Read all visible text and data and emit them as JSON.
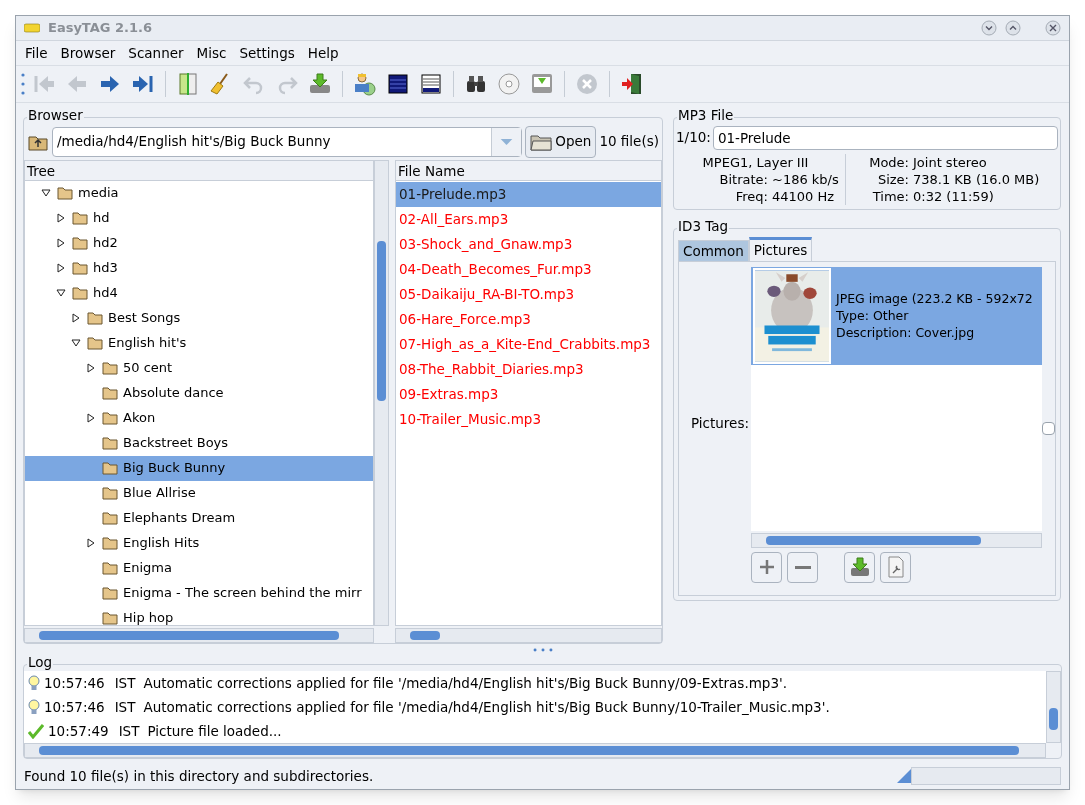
{
  "window": {
    "title": "EasyTAG 2.1.6"
  },
  "menu": [
    {
      "label": "File"
    },
    {
      "label": "Browser"
    },
    {
      "label": "Scanner"
    },
    {
      "label": "Misc"
    },
    {
      "label": "Settings"
    },
    {
      "label": "Help"
    }
  ],
  "toolbar": [
    {
      "kind": "first",
      "disabled": true
    },
    {
      "kind": "prev",
      "disabled": true
    },
    {
      "kind": "next",
      "disabled": false
    },
    {
      "kind": "last",
      "disabled": false
    },
    {
      "kind": "sep"
    },
    {
      "kind": "book",
      "disabled": false
    },
    {
      "kind": "broom",
      "disabled": false
    },
    {
      "kind": "undo",
      "disabled": true
    },
    {
      "kind": "redo",
      "disabled": true
    },
    {
      "kind": "save",
      "disabled": false
    },
    {
      "kind": "sep"
    },
    {
      "kind": "person",
      "disabled": false
    },
    {
      "kind": "list",
      "disabled": false
    },
    {
      "kind": "list2",
      "disabled": false
    },
    {
      "kind": "sep"
    },
    {
      "kind": "binoculars",
      "disabled": false
    },
    {
      "kind": "cd",
      "disabled": false
    },
    {
      "kind": "save2",
      "disabled": false
    },
    {
      "kind": "sep"
    },
    {
      "kind": "stop",
      "disabled": true
    },
    {
      "kind": "sep"
    },
    {
      "kind": "exit",
      "disabled": false
    }
  ],
  "browser": {
    "title": "Browser",
    "path": "/media/hd4/English hit's/Big Buck Bunny",
    "open_button": "Open",
    "file_count": "10 file(s)",
    "tree_header": "Tree",
    "file_header": "File Name",
    "tree": [
      {
        "label": "media",
        "kind": "node",
        "expanded": true,
        "selected": false,
        "children": [
          {
            "label": "hd",
            "kind": "node",
            "expanded": false,
            "selected": false
          },
          {
            "label": "hd2",
            "kind": "node",
            "expanded": false,
            "selected": false
          },
          {
            "label": "hd3",
            "kind": "node",
            "expanded": false,
            "selected": false
          },
          {
            "label": "hd4",
            "kind": "node",
            "expanded": true,
            "selected": false,
            "children": [
              {
                "label": "Best Songs",
                "kind": "node",
                "expanded": false,
                "selected": false
              },
              {
                "label": "English hit's",
                "kind": "node",
                "expanded": true,
                "selected": false,
                "children": [
                  {
                    "label": "50 cent",
                    "kind": "node",
                    "expanded": false,
                    "selected": false
                  },
                  {
                    "label": "Absolute dance",
                    "kind": "leaf",
                    "selected": false
                  },
                  {
                    "label": "Akon",
                    "kind": "node",
                    "expanded": false,
                    "selected": false
                  },
                  {
                    "label": "Backstreet Boys",
                    "kind": "leaf",
                    "selected": false
                  },
                  {
                    "label": "Big Buck Bunny",
                    "kind": "leaf",
                    "selected": true
                  },
                  {
                    "label": "Blue Allrise",
                    "kind": "leaf",
                    "selected": false
                  },
                  {
                    "label": "Elephants Dream",
                    "kind": "leaf",
                    "selected": false
                  },
                  {
                    "label": "English Hits",
                    "kind": "node",
                    "expanded": false,
                    "selected": false
                  },
                  {
                    "label": "Enigma",
                    "kind": "leaf",
                    "selected": false
                  },
                  {
                    "label": "Enigma - The screen behind the mirr",
                    "kind": "leaf",
                    "selected": false
                  },
                  {
                    "label": "Hip hop",
                    "kind": "leaf",
                    "selected": false
                  }
                ]
              }
            ]
          }
        ]
      }
    ],
    "files": [
      {
        "name": "01-Prelude.mp3",
        "selected": true,
        "changed": false
      },
      {
        "name": "02-All_Ears.mp3",
        "selected": false,
        "changed": true
      },
      {
        "name": "03-Shock_and_Gnaw.mp3",
        "selected": false,
        "changed": true
      },
      {
        "name": "04-Death_Becomes_Fur.mp3",
        "selected": false,
        "changed": true
      },
      {
        "name": "05-Daikaiju_RA-BI-TO.mp3",
        "selected": false,
        "changed": true
      },
      {
        "name": "06-Hare_Force.mp3",
        "selected": false,
        "changed": true
      },
      {
        "name": "07-High_as_a_Kite-End_Crabbits.mp3",
        "selected": false,
        "changed": true
      },
      {
        "name": "08-The_Rabbit_Diaries.mp3",
        "selected": false,
        "changed": true
      },
      {
        "name": "09-Extras.mp3",
        "selected": false,
        "changed": true
      },
      {
        "name": "10-Trailer_Music.mp3",
        "selected": false,
        "changed": true
      }
    ]
  },
  "mp3_file": {
    "title": "MP3 File",
    "index": "1/10:",
    "filename": "01-Prelude",
    "format": "MPEG1, Layer III",
    "left": [
      {
        "label": "Bitrate:",
        "value": "~186 kb/s"
      },
      {
        "label": "Freq:",
        "value": "44100 Hz"
      }
    ],
    "right": [
      {
        "label": "Mode:",
        "value": "Joint stereo"
      },
      {
        "label": "Size:",
        "value": "738.1 KB (16.0 MB)"
      },
      {
        "label": "Time:",
        "value": "0:32 (11:59)"
      }
    ]
  },
  "id3_tag": {
    "title": "ID3 Tag",
    "tabs": [
      {
        "label": "Common",
        "selected": false
      },
      {
        "label": "Pictures",
        "selected": true
      }
    ],
    "pictures_label": "Pictures:",
    "pictures": [
      {
        "kind": "picture",
        "selected": true,
        "lines": [
          "JPEG image (223.2 KB - 592x72",
          "Type: Other",
          "Description: Cover.jpg"
        ]
      }
    ],
    "checked": false
  },
  "log": {
    "title": "Log",
    "entries": [
      {
        "kind": "info",
        "time": "10:57:46",
        "zone": "IST",
        "message": "Automatic corrections applied for file '/media/hd4/English hit's/Big Buck Bunny/09-Extras.mp3'."
      },
      {
        "kind": "info",
        "time": "10:57:46",
        "zone": "IST",
        "message": "Automatic corrections applied for file '/media/hd4/English hit's/Big Buck Bunny/10-Trailer_Music.mp3'."
      },
      {
        "kind": "ok",
        "time": "10:57:49",
        "zone": "IST",
        "message": "Picture file loaded..."
      }
    ]
  },
  "status_bar": "Found 10 file(s) in this directory and subdirectories.",
  "progress": {
    "level": 0
  }
}
